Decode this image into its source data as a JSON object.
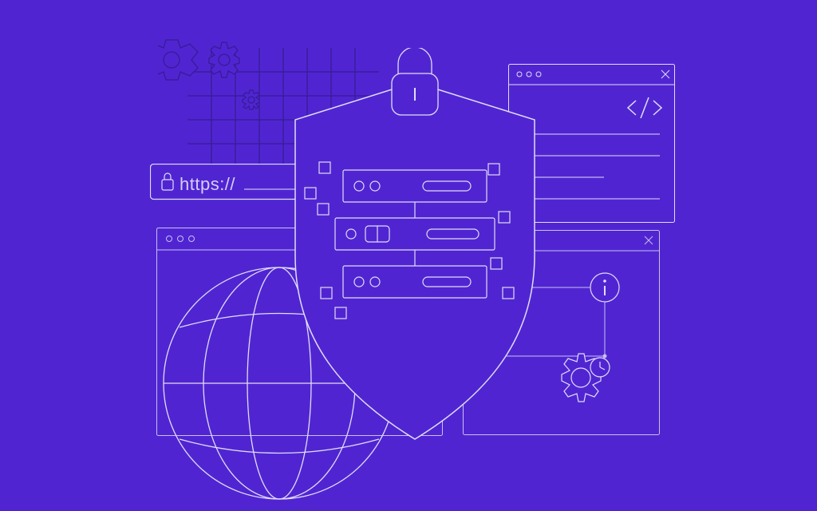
{
  "background_color": "#5025d1",
  "line_color_light": "#e2dcfa",
  "line_color_dark": "#3a1c9e",
  "address_bar": {
    "protocol_text": "https://"
  },
  "icons": {
    "padlock_small": "lock-icon",
    "padlock_large": "lock-icon",
    "shield": "shield-icon",
    "globe": "globe-icon",
    "gear_large": "gear-icon",
    "gear_medium": "gear-icon",
    "gear_small": "gear-icon",
    "gear_bottom": "gear-icon",
    "info": "info-icon",
    "code": "code-icon",
    "close": "close-icon",
    "window_dots": "window-controls-icon",
    "clock": "clock-icon"
  },
  "illustration_theme": "web-security"
}
